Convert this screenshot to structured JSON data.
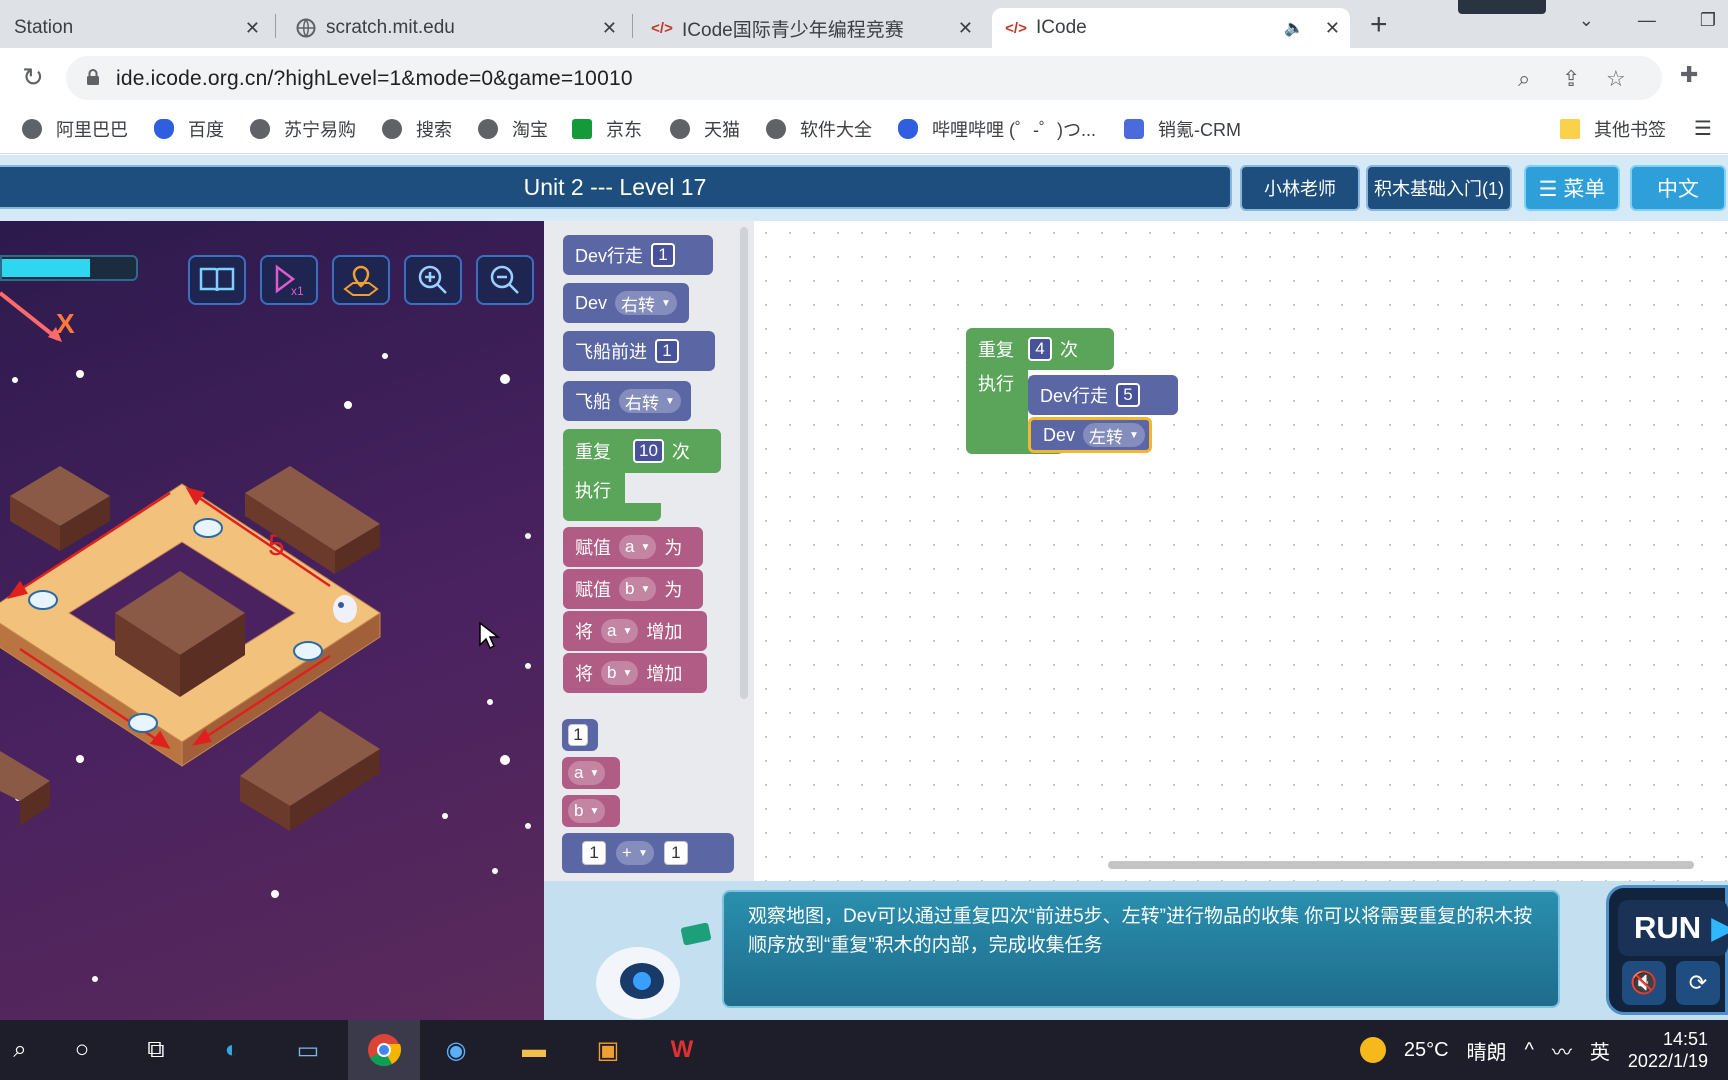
{
  "browser": {
    "tabs": [
      {
        "label": "Station"
      },
      {
        "label": "scratch.mit.edu"
      },
      {
        "label": "ICode国际青少年编程竞赛"
      },
      {
        "label": "ICode"
      }
    ],
    "url": "ide.icode.org.cn/?highLevel=1&mode=0&game=10010",
    "bookmarks": [
      "阿里巴巴",
      "百度",
      "苏宁易购",
      "搜索",
      "淘宝",
      "京东",
      "天猫",
      "软件大全",
      "哔哩哔哩 (゜-゜)つ...",
      "销氪-CRM",
      "其他书签"
    ]
  },
  "header": {
    "level_title": "Unit 2 --- Level 17",
    "teacher": "小林老师",
    "course": "积木基础入门(1)",
    "menu": "☰ 菜单",
    "language": "中文"
  },
  "game": {
    "hp_fraction": 0.66,
    "marker_x": "X",
    "path_number": "5"
  },
  "toolbox": {
    "dev_walk": {
      "label": "Dev行走",
      "value": "1"
    },
    "dev_turn": {
      "label": "Dev",
      "option": "右转"
    },
    "ship_forward": {
      "label": "飞船前进",
      "value": "1"
    },
    "ship_turn": {
      "label": "飞船",
      "option": "右转"
    },
    "repeat": {
      "label": "重复",
      "value": "10",
      "unit": "次",
      "do": "执行"
    },
    "assign_a": {
      "label": "赋值",
      "var": "a",
      "suffix": "为"
    },
    "assign_b": {
      "label": "赋值",
      "var": "b",
      "suffix": "为"
    },
    "inc_a": {
      "label": "将",
      "var": "a",
      "suffix": "增加"
    },
    "inc_b": {
      "label": "将",
      "var": "b",
      "suffix": "增加"
    },
    "num": "1",
    "var_a": "a",
    "var_b": "b",
    "math": {
      "left": "1",
      "op": "+",
      "right": "1"
    }
  },
  "workspace": {
    "repeat": {
      "label": "重复",
      "value": "4",
      "unit": "次",
      "do": "执行"
    },
    "dev_walk": {
      "label": "Dev行走",
      "value": "5"
    },
    "dev_turn": {
      "label": "Dev",
      "option": "左转"
    }
  },
  "hint": {
    "text": "观察地图，Dev可以通过重复四次“前进5步、左转”进行物品的收集 你可以将需要重复的积木按顺序放到“重复”积木的内部，完成收集任务"
  },
  "run": {
    "label": "RUN"
  },
  "taskbar": {
    "weather_temp": "25°C",
    "weather_desc": "晴朗",
    "ime": "英",
    "time": "14:51",
    "date": "2022/1/19"
  },
  "colors": {
    "header_blue": "#1d4e7d",
    "block_purple": "#5b67a5",
    "block_pink": "#b05c85",
    "block_green": "#5ba55b",
    "highlight": "#f2b630"
  }
}
